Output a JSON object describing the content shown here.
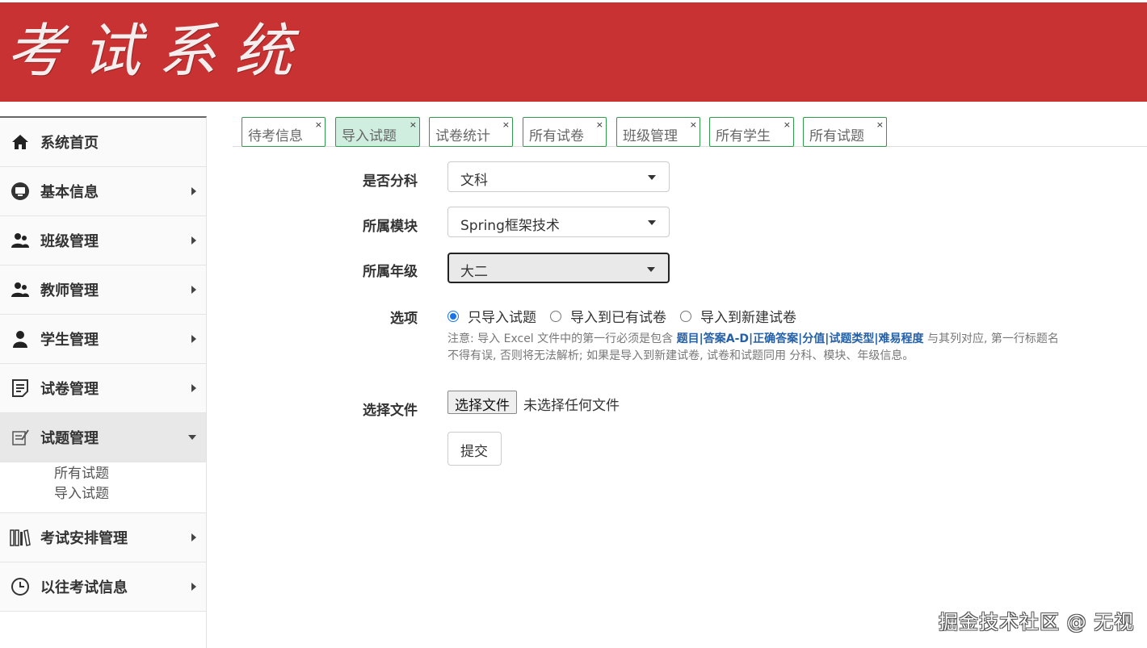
{
  "header": {
    "logo_text": "考试系统",
    "bg_color": "#c83232"
  },
  "sidebar": {
    "items": [
      {
        "label": "系统首页",
        "icon": "home-icon"
      },
      {
        "label": "基本信息",
        "icon": "monitor-icon"
      },
      {
        "label": "班级管理",
        "icon": "users-icon"
      },
      {
        "label": "教师管理",
        "icon": "users-icon"
      },
      {
        "label": "学生管理",
        "icon": "user-icon"
      },
      {
        "label": "试卷管理",
        "icon": "document-icon"
      },
      {
        "label": "试题管理",
        "icon": "edit-note-icon"
      },
      {
        "label": "考试安排管理",
        "icon": "books-icon"
      },
      {
        "label": "以往考试信息",
        "icon": "clock-icon"
      }
    ],
    "submenu": [
      "所有试题",
      "导入试题"
    ]
  },
  "tabs": [
    {
      "label": "待考信息",
      "close": "×"
    },
    {
      "label": "导入试题",
      "close": "×",
      "active": true
    },
    {
      "label": "试卷统计",
      "close": "×"
    },
    {
      "label": "所有试卷",
      "close": "×"
    },
    {
      "label": "班级管理",
      "close": "×"
    },
    {
      "label": "所有学生",
      "close": "×"
    },
    {
      "label": "所有试题",
      "close": "×"
    }
  ],
  "form": {
    "subject_label": "是否分科",
    "subject_value": "文科",
    "module_label": "所属模块",
    "module_value": "Spring框架技术",
    "grade_label": "所属年级",
    "grade_value": "大二",
    "option_label": "选项",
    "options": [
      "只导入试题",
      "导入到已有试卷",
      "导入到新建试卷"
    ],
    "selected_option": "只导入试题",
    "note_prefix": "注意: 导入 Excel 文件中的第一行必须是包含 ",
    "note_fields": [
      "题目",
      "答案A-D",
      "正确答案",
      "分值",
      "试题类型",
      "难易程度"
    ],
    "note_suffix": " 与其列对应, 第一行标题名不得有误, 否则将无法解析; 如果是导入到新建试卷, 试卷和试题同用 分科、模块、年级信息。",
    "file_label": "选择文件",
    "file_button": "选择文件",
    "file_status": "未选择任何文件",
    "submit_label": "提交"
  },
  "watermark": "掘金技术社区 @ 无视"
}
